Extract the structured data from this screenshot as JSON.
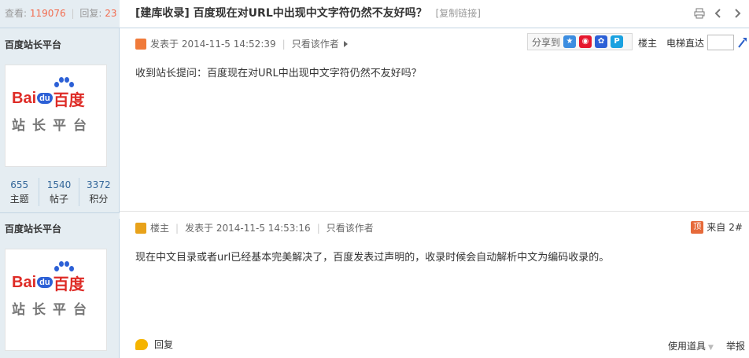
{
  "stats": {
    "views_label": "查看:",
    "views": "119076",
    "replies_label": "回复:",
    "replies": "23"
  },
  "thread": {
    "title": "[建库收录] 百度现在对URL中出现中文字符仍然不友好吗？",
    "copy_link": "[复制链接]"
  },
  "header_icons": [
    "print-icon",
    "previous-thread-icon",
    "next-thread-icon"
  ],
  "author1": {
    "name": "百度站长平台",
    "logo": {
      "bai": "Bai",
      "du": "du",
      "brand": "百度",
      "sub": "站长平台"
    },
    "stats": [
      {
        "value": "655",
        "label": "主题"
      },
      {
        "value": "1540",
        "label": "帖子"
      },
      {
        "value": "3372",
        "label": "积分"
      }
    ]
  },
  "author2": {
    "name": "百度站长平台",
    "logo": {
      "bai": "Bai",
      "du": "du",
      "brand": "百度",
      "sub": "站长平台"
    }
  },
  "post1": {
    "posted": "发表于 2014-11-5 14:52:39",
    "only_author": "只看该作者",
    "share_label": "分享到",
    "floor": "楼主",
    "goto_label": "电梯直达",
    "goto_value": "",
    "body": "收到站长提问：百度现在对URL中出现中文字符仍然不友好吗？"
  },
  "post2": {
    "floor": "楼主",
    "posted": "发表于 2014-11-5 14:53:16",
    "only_author": "只看该作者",
    "from": "来自",
    "floor_num": "2#",
    "body": "现在中文目录或者url已经基本完美解决了，百度发表过声明的，收录时候会自动解析中文为编码收录的。",
    "reply": "回复",
    "use_tool": "使用道具",
    "report": "举报"
  },
  "colors": {
    "sidebar_bg": "#e5edf2",
    "accent_number": "#f26c4f",
    "link_blue": "#336699",
    "brand_red": "#de2b26",
    "brand_blue": "#2c60d6"
  }
}
